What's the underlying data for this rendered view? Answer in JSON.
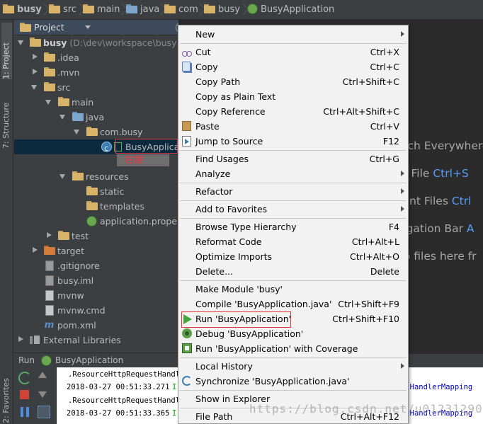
{
  "breadcrumb": [
    "busy",
    "src",
    "main",
    "java",
    "com",
    "busy",
    "BusyApplication"
  ],
  "left_strip": {
    "project_tab": "1: Project",
    "structure_tab": "7: Structure",
    "favorites_tab": "2: Favorites"
  },
  "project_panel": {
    "title": "Project",
    "tree": [
      {
        "label": "busy",
        "path": " (D:\\dev\\workspace\\busy)"
      },
      {
        "label": ".idea"
      },
      {
        "label": ".mvn"
      },
      {
        "label": "src"
      },
      {
        "label": "main"
      },
      {
        "label": "java"
      },
      {
        "label": "com.busy"
      },
      {
        "label": "BusyApplication"
      },
      {
        "label": "resources"
      },
      {
        "label": "static"
      },
      {
        "label": "templates"
      },
      {
        "label": "application.properties"
      },
      {
        "label": "test"
      },
      {
        "label": "target"
      },
      {
        "label": ".gitignore"
      },
      {
        "label": "busy.iml"
      },
      {
        "label": "mvnw"
      },
      {
        "label": "mvnw.cmd"
      },
      {
        "label": "pom.xml"
      },
      {
        "label": "External Libraries"
      }
    ],
    "annotation": "右键"
  },
  "editor_hints": [
    {
      "text": "arch Everywhere",
      "key": ""
    },
    {
      "text": " to File ",
      "key": "Ctrl+S"
    },
    {
      "text": "cent Files ",
      "key": "Ctrl"
    },
    {
      "text": "vigation Bar ",
      "key": "A"
    },
    {
      "text": "op files here fr",
      "key": ""
    }
  ],
  "run_panel": {
    "label": "Run",
    "config": "BusyApplication",
    "console": [
      {
        "text": ".ResourceHttpRequestHandl"
      },
      {
        "time": "2018-03-27 00:51:33.271",
        "level": "I",
        "tail": "rlHandlerMapping"
      },
      {
        "text": ".ResourceHttpRequestHandl"
      },
      {
        "time": "2018-03-27 00:51:33.365",
        "level": "I",
        "tail": "rlHandlerMapping"
      }
    ]
  },
  "context_menu": {
    "items": [
      {
        "label": "New",
        "shortcut": "",
        "submenu": true
      },
      {
        "label": "Cut",
        "shortcut": "Ctrl+X"
      },
      {
        "label": "Copy",
        "shortcut": "Ctrl+C"
      },
      {
        "label": "Copy Path",
        "shortcut": "Ctrl+Shift+C"
      },
      {
        "label": "Copy as Plain Text",
        "shortcut": ""
      },
      {
        "label": "Copy Reference",
        "shortcut": "Ctrl+Alt+Shift+C"
      },
      {
        "label": "Paste",
        "shortcut": "Ctrl+V"
      },
      {
        "label": "Jump to Source",
        "shortcut": "F12"
      },
      {
        "label": "Find Usages",
        "shortcut": "Ctrl+G"
      },
      {
        "label": "Analyze",
        "shortcut": "",
        "submenu": true
      },
      {
        "label": "Refactor",
        "shortcut": "",
        "submenu": true
      },
      {
        "label": "Add to Favorites",
        "shortcut": "",
        "submenu": true
      },
      {
        "label": "Browse Type Hierarchy",
        "shortcut": "F4"
      },
      {
        "label": "Reformat Code",
        "shortcut": "Ctrl+Alt+L"
      },
      {
        "label": "Optimize Imports",
        "shortcut": "Ctrl+Alt+O"
      },
      {
        "label": "Delete...",
        "shortcut": "Delete"
      },
      {
        "label": "Make Module 'busy'",
        "shortcut": ""
      },
      {
        "label": "Compile 'BusyApplication.java'",
        "shortcut": "Ctrl+Shift+F9"
      },
      {
        "label": "Run 'BusyApplication'",
        "shortcut": "Ctrl+Shift+F10"
      },
      {
        "label": "Debug 'BusyApplication'",
        "shortcut": ""
      },
      {
        "label": "Run 'BusyApplication' with Coverage",
        "shortcut": ""
      },
      {
        "label": "Local History",
        "shortcut": "",
        "submenu": true
      },
      {
        "label": "Synchronize 'BusyApplication.java'",
        "shortcut": ""
      },
      {
        "label": "Show in Explorer",
        "shortcut": ""
      },
      {
        "label": "File Path",
        "shortcut": "Ctrl+Alt+F12"
      }
    ]
  },
  "watermark": "https://blog.csdn.net/u012312907",
  "colors": {
    "selection": "#0d293e",
    "annotation": "#e0393e",
    "menu_bg": "#f2f2f2",
    "run_green": "#3ea83e"
  }
}
